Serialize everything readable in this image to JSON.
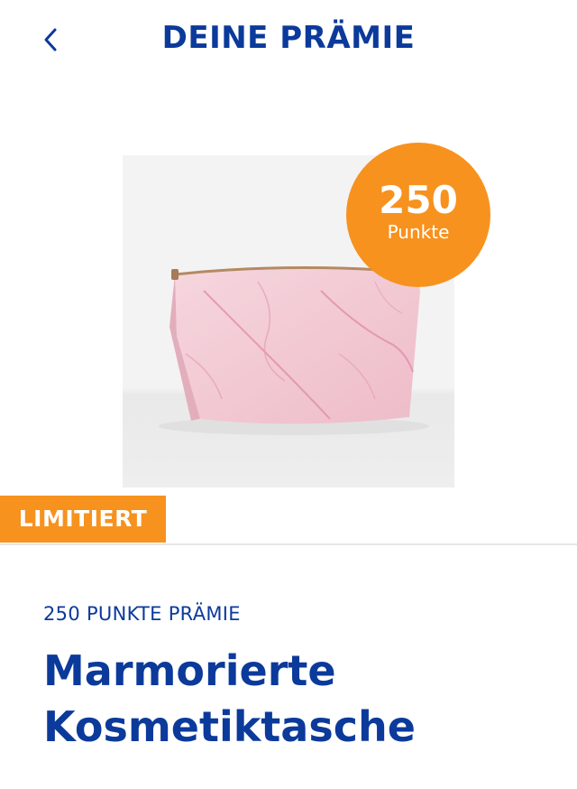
{
  "header": {
    "back_icon": "chevron-left-icon",
    "title": "DEINE PRÄMIE"
  },
  "product": {
    "image_description": "pink-marble-cosmetic-bag",
    "badge": {
      "points": "250",
      "unit": "Punkte"
    },
    "limited_label": "LIMITIERT",
    "category": "250 PUNKTE PRÄMIE",
    "name": "Marmorierte Kosmetiktasche"
  },
  "colors": {
    "brand_blue": "#0b3a9b",
    "accent_orange": "#f7921e",
    "bag_pink": "#f2c9d3"
  }
}
